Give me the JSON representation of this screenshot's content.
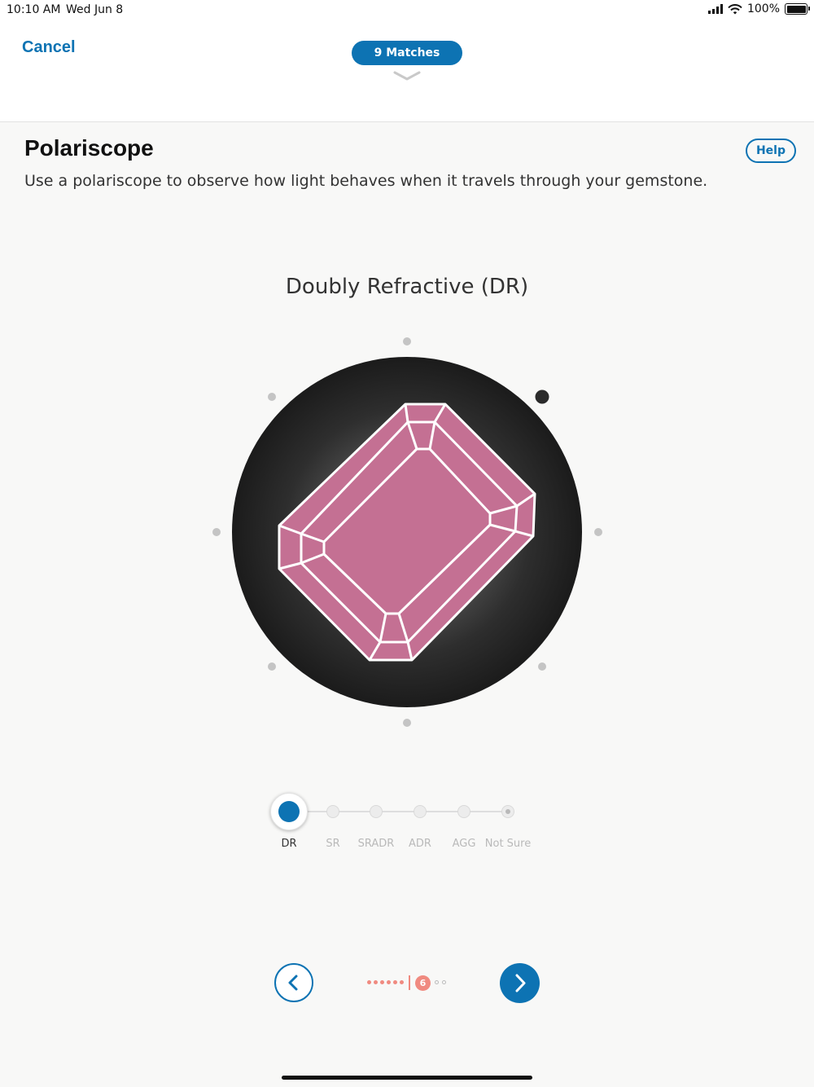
{
  "status_bar": {
    "time": "10:10 AM",
    "date": "Wed Jun 8",
    "battery": "100%"
  },
  "header": {
    "cancel_label": "Cancel",
    "matches_label": "9 Matches"
  },
  "page": {
    "title": "Polariscope",
    "help_label": "Help",
    "subtitle": "Use a polariscope to observe how light behaves when it travels through your gemstone."
  },
  "selection": {
    "label": "Doubly Refractive (DR)"
  },
  "gem_view": {
    "gem_color": "#c47093",
    "active_marker": "top-right"
  },
  "slider": {
    "options": [
      "DR",
      "SR",
      "SRADR",
      "ADR",
      "AGG",
      "Not Sure"
    ],
    "selected": "DR"
  },
  "steps": {
    "current": "6",
    "completed": 5,
    "remaining": 2
  },
  "colors": {
    "accent": "#0d73b3",
    "progress": "#f08a80"
  }
}
